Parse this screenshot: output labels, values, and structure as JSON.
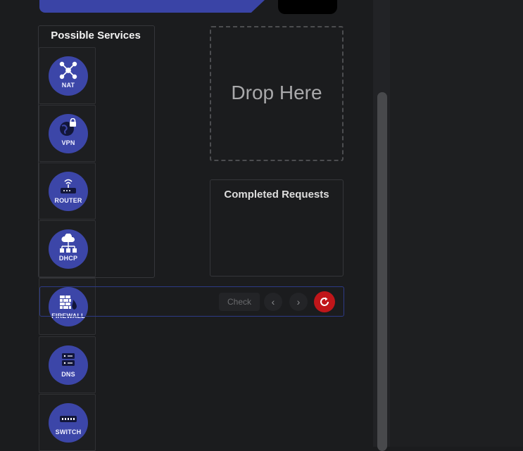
{
  "services": {
    "title": "Possible Services",
    "items": [
      {
        "label": "NAT",
        "icon": "network-hub-icon"
      },
      {
        "label": "VPN",
        "icon": "globe-lock-icon"
      },
      {
        "label": "ROUTER",
        "icon": "router-icon"
      },
      {
        "label": "DHCP",
        "icon": "cloud-network-icon"
      },
      {
        "label": "FIREWALL",
        "icon": "firewall-icon"
      },
      {
        "label": "DNS",
        "icon": "server-stack-icon"
      },
      {
        "label": "SWITCH",
        "icon": "switch-icon"
      }
    ]
  },
  "drop_zone": {
    "label": "Drop Here"
  },
  "completed": {
    "title": "Completed Requests"
  },
  "controls": {
    "check_label": "Check",
    "prev_label": "‹",
    "next_label": "›"
  },
  "colors": {
    "accent": "#3c46a8",
    "danger": "#c0161a",
    "background": "#1b1c1e"
  }
}
